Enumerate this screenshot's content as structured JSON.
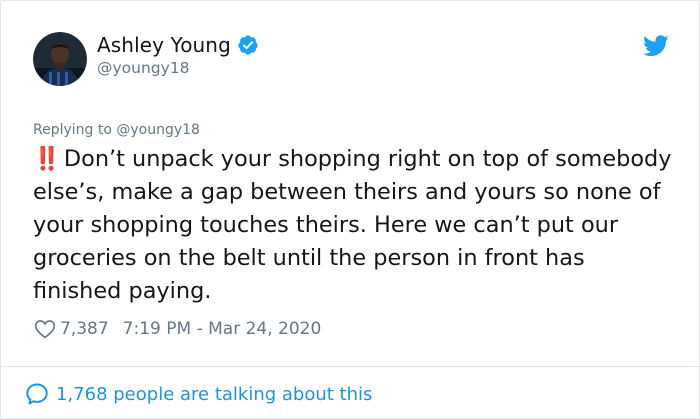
{
  "author": {
    "display_name": "Ashley Young",
    "handle": "@youngy18",
    "verified": true
  },
  "icons": {
    "verified": "verified-badge-icon",
    "brand": "twitter-bird-icon",
    "like": "heart-icon",
    "conversation": "speech-bubble-icon"
  },
  "colors": {
    "brand_blue": "#1da1f2",
    "link_blue": "#1b95e0",
    "muted": "#657786",
    "emphasis_red": "#d8202d"
  },
  "tweet": {
    "replying_to": "Replying to @youngy18",
    "emoji": "‼️",
    "text": "Don’t unpack your shopping right on top of somebody else’s, make a gap between theirs and yours so none of your shopping touches theirs. Here we can’t put our groceries on the belt until the person in front has finished paying.",
    "likes": "7,387",
    "timestamp": "7:19 PM - Mar 24, 2020"
  },
  "conversation": {
    "label": "1,768 people are talking about this"
  }
}
